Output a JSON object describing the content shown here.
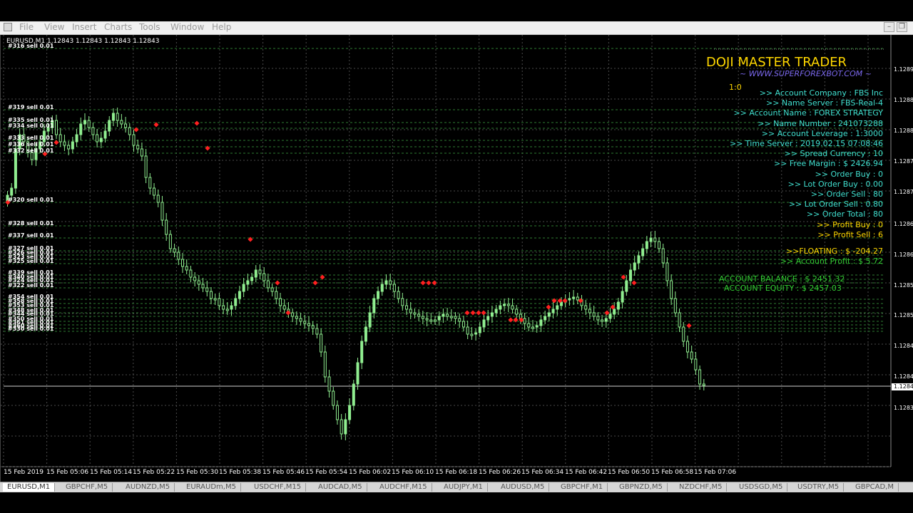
{
  "menu": {
    "items": [
      "File",
      "View",
      "Insert",
      "Charts",
      "Tools",
      "Window",
      "Help"
    ]
  },
  "chart": {
    "header": "EURUSD,M1  1.12843 1.12843 1.12843 1.12843",
    "bg": "#000000",
    "grid_color": "#4a4a4a",
    "candle_color": "#90ee90",
    "marker_color": "#ff2020",
    "y_ticks": [
      "1.1289",
      "1.1288",
      "1.1288",
      "1.1287",
      "1.1287",
      "1.1286",
      "1.1286",
      "1.1285",
      "1.1285",
      "1.1284",
      "1.1284",
      "1.1283"
    ],
    "current_price": "1.1284",
    "x_ticks": [
      "15 Feb 2019",
      "15 Feb 05:06",
      "15 Feb 05:14",
      "15 Feb 05:22",
      "15 Feb 05:30",
      "15 Feb 05:38",
      "15 Feb 05:46",
      "15 Feb 05:54",
      "15 Feb 06:02",
      "15 Feb 06:10",
      "15 Feb 06:18",
      "15 Feb 06:26",
      "15 Feb 06:34",
      "15 Feb 06:42",
      "15 Feb 06:50",
      "15 Feb 06:58",
      "15 Feb 07:06"
    ],
    "trade_labels": [
      "#316 sell 0.01",
      "#319 sell 0.01",
      "#335 sell 0.01",
      "#334 sell 0.01",
      "#333 sell 0.01",
      "#336 sell 0.01",
      "#332 sell 0.01",
      "#320 sell 0.01",
      "#328 sell 0.01",
      "#337 sell 0.01",
      "#327 sell 0.01",
      "#326 sell 0.01",
      "#323 sell 0.01",
      "#325 sell 0.01",
      "#339 sell 0.01",
      "#340 sell 0.01",
      "#324 sell 0.01",
      "#322 sell 0.01",
      "#354 sell 0.01",
      "#358 sell 0.01",
      "#353 sell 0.01",
      "#348 sell 0.01",
      "#344 sell 0.01",
      "#350 sell 0.01",
      "#361 sell 0.01",
      "#360 sell 0.01",
      "#330 sell 0.01"
    ]
  },
  "panel": {
    "title": "DOJI MASTER TRADER",
    "subtitle": "~ WWW.SUPERFOREXBOT.COM ~",
    "ratio": "1:0",
    "lines": [
      {
        "text": ">> Account Company  : FBS Inc",
        "color": "#40e0d0"
      },
      {
        "text": ">> Name Server  : FBS-Real-4",
        "color": "#40e0d0"
      },
      {
        "text": ">> Account Name  : FOREX STRATEGY",
        "color": "#40e0d0"
      },
      {
        "text": ">> Name Number  : 241073288",
        "color": "#40e0d0"
      },
      {
        "text": ">> Account Leverage  : 1:3000",
        "color": "#40e0d0"
      },
      {
        "text": ">> Time Server  : 2019.02.15 07:08:46",
        "color": "#40e0d0"
      },
      {
        "text": ">> Spread Currency  : 10",
        "color": "#40e0d0"
      },
      {
        "text": ">> Free Margin  : $ 2426.94",
        "color": "#40e0d0"
      },
      {
        "text": ">> Order Buy  : 0",
        "color": "#40e0d0"
      },
      {
        "text": ">> Lot Order Buy  : 0.00",
        "color": "#40e0d0"
      },
      {
        "text": ">> Order Sell  : 80",
        "color": "#40e0d0"
      },
      {
        "text": ">> Lot Order Sell  : 0.80",
        "color": "#40e0d0"
      },
      {
        "text": ">> Order Total  : 80",
        "color": "#40e0d0"
      },
      {
        "text": ">> Profit Buy  : 0",
        "color": "#ffd700"
      },
      {
        "text": ">> Profit Sell  : 6",
        "color": "#ffd700"
      }
    ],
    "floating": ">>FLOATING  :  $  -204.27",
    "account_profit": ">> Account Profit  :  $ 5.72",
    "balance": "ACCOUNT BALANCE  :   $   2451.32",
    "equity": "ACCOUNT EQUITY   :   $   2457.03",
    "floating_color": "#ffd700",
    "profit_color": "#32cd32",
    "balance_color": "#32cd32"
  },
  "tabs": [
    "EURUSD,M1",
    "GBPCHF,M5",
    "AUDNZD,M5",
    "EURAUDm,M5",
    "USDCHF,M15",
    "AUDCAD,M5",
    "AUDCHF,M15",
    "AUDJPY,M1",
    "AUDUSD,M5",
    "GBPCHF,M1",
    "GBPNZD,M5",
    "NZDCHF,M5",
    "USDSGD,M5",
    "USDTRY,M5",
    "GBPCAD,M"
  ]
}
